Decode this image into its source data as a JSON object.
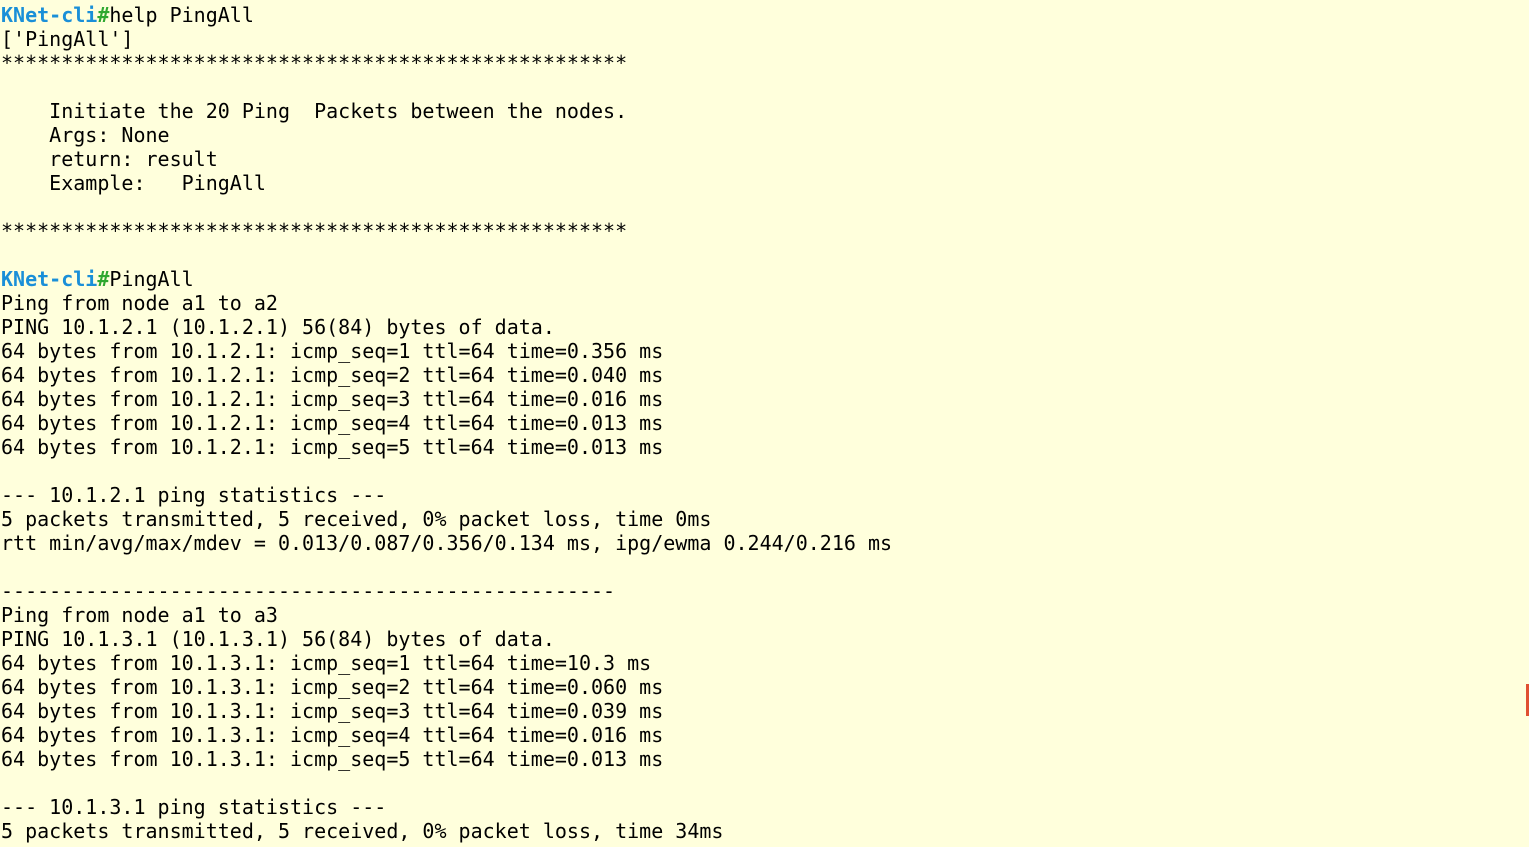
{
  "prompt": {
    "host": "KNet-cli",
    "symbol": "#"
  },
  "lines": [
    {
      "type": "prompt",
      "command": "help PingAll"
    },
    {
      "type": "text",
      "text": "['PingAll']"
    },
    {
      "type": "text",
      "text": "****************************************************"
    },
    {
      "type": "text",
      "text": ""
    },
    {
      "type": "text",
      "text": "    Initiate the 20 Ping  Packets between the nodes."
    },
    {
      "type": "text",
      "text": "    Args: None"
    },
    {
      "type": "text",
      "text": "    return: result"
    },
    {
      "type": "text",
      "text": "    Example:   PingAll"
    },
    {
      "type": "text",
      "text": ""
    },
    {
      "type": "text",
      "text": "****************************************************"
    },
    {
      "type": "text",
      "text": ""
    },
    {
      "type": "prompt",
      "command": "PingAll"
    },
    {
      "type": "text",
      "text": "Ping from node a1 to a2"
    },
    {
      "type": "text",
      "text": "PING 10.1.2.1 (10.1.2.1) 56(84) bytes of data."
    },
    {
      "type": "text",
      "text": "64 bytes from 10.1.2.1: icmp_seq=1 ttl=64 time=0.356 ms"
    },
    {
      "type": "text",
      "text": "64 bytes from 10.1.2.1: icmp_seq=2 ttl=64 time=0.040 ms"
    },
    {
      "type": "text",
      "text": "64 bytes from 10.1.2.1: icmp_seq=3 ttl=64 time=0.016 ms"
    },
    {
      "type": "text",
      "text": "64 bytes from 10.1.2.1: icmp_seq=4 ttl=64 time=0.013 ms"
    },
    {
      "type": "text",
      "text": "64 bytes from 10.1.2.1: icmp_seq=5 ttl=64 time=0.013 ms"
    },
    {
      "type": "text",
      "text": ""
    },
    {
      "type": "text",
      "text": "--- 10.1.2.1 ping statistics ---"
    },
    {
      "type": "text",
      "text": "5 packets transmitted, 5 received, 0% packet loss, time 0ms"
    },
    {
      "type": "text",
      "text": "rtt min/avg/max/mdev = 0.013/0.087/0.356/0.134 ms, ipg/ewma 0.244/0.216 ms"
    },
    {
      "type": "text",
      "text": ""
    },
    {
      "type": "text",
      "text": "---------------------------------------------------"
    },
    {
      "type": "text",
      "text": "Ping from node a1 to a3"
    },
    {
      "type": "text",
      "text": "PING 10.1.3.1 (10.1.3.1) 56(84) bytes of data."
    },
    {
      "type": "text",
      "text": "64 bytes from 10.1.3.1: icmp_seq=1 ttl=64 time=10.3 ms"
    },
    {
      "type": "text",
      "text": "64 bytes from 10.1.3.1: icmp_seq=2 ttl=64 time=0.060 ms"
    },
    {
      "type": "text",
      "text": "64 bytes from 10.1.3.1: icmp_seq=3 ttl=64 time=0.039 ms"
    },
    {
      "type": "text",
      "text": "64 bytes from 10.1.3.1: icmp_seq=4 ttl=64 time=0.016 ms"
    },
    {
      "type": "text",
      "text": "64 bytes from 10.1.3.1: icmp_seq=5 ttl=64 time=0.013 ms"
    },
    {
      "type": "text",
      "text": ""
    },
    {
      "type": "text",
      "text": "--- 10.1.3.1 ping statistics ---"
    },
    {
      "type": "text",
      "text": "5 packets transmitted, 5 received, 0% packet loss, time 34ms"
    }
  ],
  "colors": {
    "background": "#ffffdc",
    "prompt_host": "#1a8fd8",
    "prompt_hash": "#2fa82f",
    "text": "#000000"
  }
}
